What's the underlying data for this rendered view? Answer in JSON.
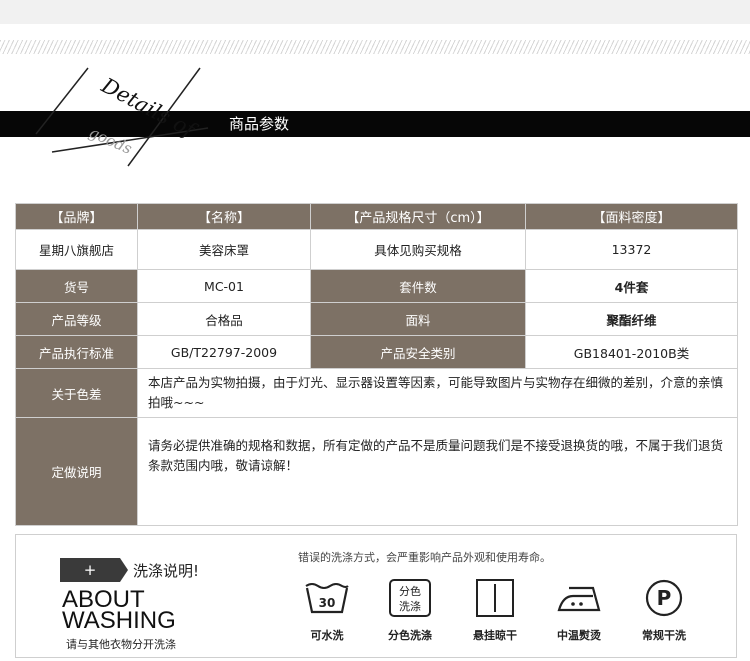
{
  "header": {
    "badge_line1": "Details of",
    "badge_line2": "goods",
    "title": "商品参数"
  },
  "table": {
    "head": [
      "【品牌】",
      "【名称】",
      "【产品规格尺寸（cm）】",
      "【面料密度】"
    ],
    "row1": [
      "星期八旗舰店",
      "美容床罩",
      "具体见购买规格",
      "13372"
    ],
    "rows": [
      {
        "k1": "货号",
        "v1": "MC-01",
        "k2": "套件数",
        "v2": "4件套"
      },
      {
        "k1": "产品等级",
        "v1": "合格品",
        "k2": "面料",
        "v2": "聚酯纤维"
      },
      {
        "k1": "产品执行标准",
        "v1": "GB/T22797-2009",
        "k2": "产品安全类别",
        "v2": "GB18401-2010B类"
      }
    ],
    "color_label": "关于色差",
    "color_text": "本店产品为实物拍摄，由于灯光、显示器设置等因素，可能导致图片与实物存在细微的差别，介意的亲慎拍哦~~~",
    "custom_label": "定做说明",
    "custom_text": "请务必提供准确的规格和数据，所有定做的产品不是质量问题我们是不接受退换货的哦，不属于我们退货条款范围内哦，敬请谅解！"
  },
  "washing": {
    "plus": "+",
    "title": "洗涤说明!",
    "about_line1": "ABOUT",
    "about_line2": "WASHING",
    "subtitle": "请与其他衣物分开洗涤",
    "warning": "错误的洗涤方式，会严重影响产品外观和使用寿命。",
    "icons": [
      {
        "icon": "washtub-icon",
        "glyph": "30",
        "label": "可水洗"
      },
      {
        "icon": "separate-wash-icon",
        "glyph_line1": "分色",
        "glyph_line2": "洗涤",
        "label": "分色洗涤"
      },
      {
        "icon": "hang-dry-icon",
        "label": "悬挂晾干"
      },
      {
        "icon": "iron-icon",
        "label": "中温熨烫"
      },
      {
        "icon": "dry-clean-icon",
        "glyph": "P",
        "label": "常规干洗"
      }
    ]
  },
  "colors": {
    "header_bar": "#060606",
    "table_key_bg": "#7d7165",
    "border": "#cfcfcf"
  }
}
